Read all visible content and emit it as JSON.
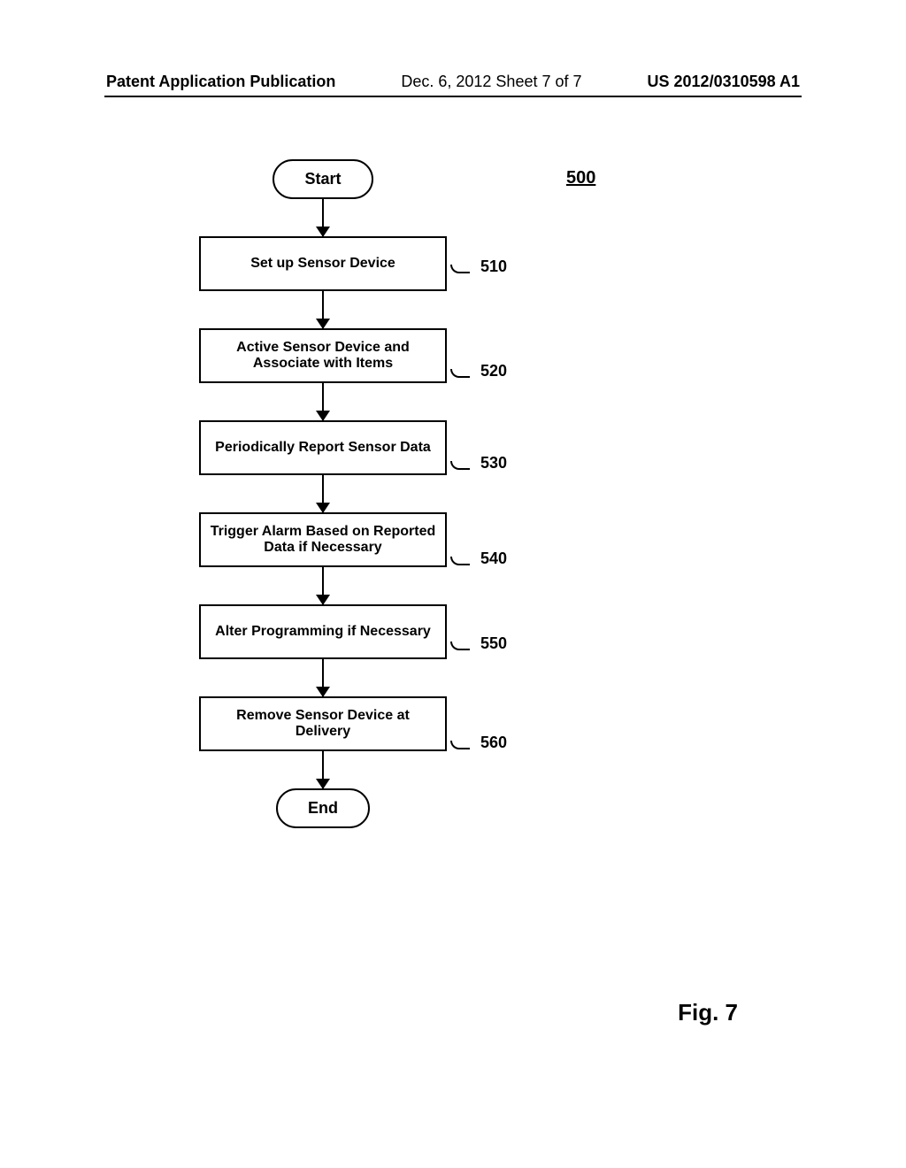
{
  "header": {
    "left": "Patent Application Publication",
    "center": "Dec. 6, 2012   Sheet 7 of 7",
    "right": "US 2012/0310598 A1"
  },
  "figure": {
    "number": "500",
    "caption": "Fig. 7"
  },
  "flow": {
    "start": "Start",
    "end": "End",
    "steps": [
      {
        "label": "Set up Sensor Device",
        "ref": "510"
      },
      {
        "label": "Active Sensor Device and Associate with Items",
        "ref": "520"
      },
      {
        "label": "Periodically Report Sensor Data",
        "ref": "530"
      },
      {
        "label": "Trigger Alarm Based on Reported Data if Necessary",
        "ref": "540"
      },
      {
        "label": "Alter Programming if Necessary",
        "ref": "550"
      },
      {
        "label": "Remove Sensor Device at Delivery",
        "ref": "560"
      }
    ]
  }
}
